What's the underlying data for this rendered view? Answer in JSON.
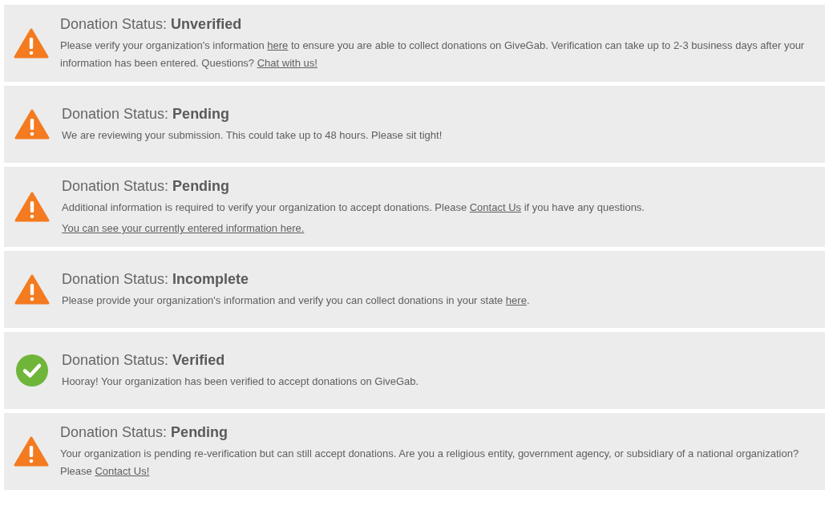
{
  "notices": [
    {
      "kind": "warning",
      "label": "Donation Status:",
      "status": "Unverified",
      "lines": [
        [
          {
            "kind": "text",
            "text": "Please verify your organization's information "
          },
          {
            "kind": "link",
            "text": "here"
          },
          {
            "kind": "text",
            "text": " to ensure you are able to collect donations on GiveGab. Verification can take up to 2-3 business days after your information has been entered. Questions? "
          },
          {
            "kind": "link",
            "text": "Chat with us!"
          }
        ]
      ]
    },
    {
      "kind": "warning",
      "label": "Donation Status:",
      "status": "Pending",
      "lines": [
        [
          {
            "kind": "text",
            "text": "We are reviewing your submission. This could take up to 48 hours. Please sit tight!"
          }
        ]
      ]
    },
    {
      "kind": "warning",
      "label": "Donation Status:",
      "status": "Pending",
      "lines": [
        [
          {
            "kind": "text",
            "text": "Additional information is required to verify your organization to accept donations. Please "
          },
          {
            "kind": "link",
            "text": "Contact Us"
          },
          {
            "kind": "text",
            "text": " if you have any questions."
          }
        ],
        [
          {
            "kind": "link",
            "text": "You can see your currently entered information here."
          }
        ]
      ]
    },
    {
      "kind": "warning",
      "label": "Donation Status:",
      "status": "Incomplete",
      "lines": [
        [
          {
            "kind": "text",
            "text": "Please provide your organization's information and verify you can collect donations in your state "
          },
          {
            "kind": "link",
            "text": "here"
          },
          {
            "kind": "text",
            "text": "."
          }
        ]
      ]
    },
    {
      "kind": "success",
      "label": "Donation Status:",
      "status": "Verified",
      "lines": [
        [
          {
            "kind": "text",
            "text": "Hooray! Your organization has been verified to accept donations on GiveGab."
          }
        ]
      ]
    },
    {
      "kind": "warning",
      "label": "Donation Status:",
      "status": "Pending",
      "lines": [
        [
          {
            "kind": "text",
            "text": "Your organization is pending re-verification but can still accept donations. Are you a religious entity, government agency, or subsidiary of a national organization? Please "
          },
          {
            "kind": "link",
            "text": "Contact Us!"
          }
        ]
      ]
    }
  ]
}
